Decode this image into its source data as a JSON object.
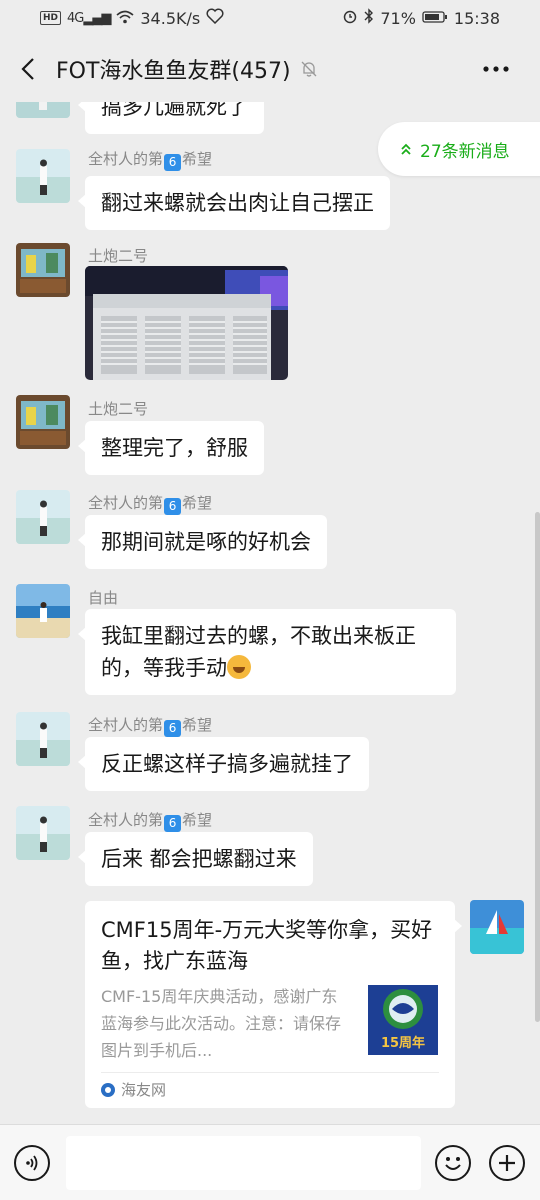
{
  "status_bar": {
    "network_badge": "HD",
    "signal": "4G",
    "speed": "34.5K/s",
    "battery": "71%",
    "time": "15:38"
  },
  "header": {
    "title": "FOT海水鱼鱼友群(457)",
    "more_label": "···"
  },
  "new_messages": "27条新消息",
  "messages": [
    {
      "sender": "",
      "text": "搞多几遍就死了"
    },
    {
      "sender": "全村人的第6希望",
      "text": "翻过来螺就会出肉让自己摆正"
    },
    {
      "sender": "土炮二号",
      "text": ""
    },
    {
      "sender": "土炮二号",
      "text": "整理完了，舒服"
    },
    {
      "sender": "全村人的第6希望",
      "text": "那期间就是啄的好机会"
    },
    {
      "sender": "自由",
      "text": "我缸里翻过去的螺，不敢出来板正的，等我手动"
    },
    {
      "sender": "全村人的第6希望",
      "text": "反正螺这样子搞多遍就挂了"
    },
    {
      "sender": "全村人的第6希望",
      "text": "后来 都会把螺翻过来"
    }
  ],
  "sender_parts": {
    "village_prefix": "全村人的第",
    "village_badge": "6",
    "village_suffix": "希望"
  },
  "link_card": {
    "title": "CMF15周年-万元大奖等你拿，买好鱼，找广东蓝海",
    "description": "CMF-15周年庆典活动，感谢广东蓝海参与此次活动。注意：请保存图片到手机后...",
    "thumb_text": "15周年",
    "source": "海友网"
  },
  "colors": {
    "accent_green": "#1aad19",
    "background": "#ededed",
    "bubble": "#ffffff"
  }
}
